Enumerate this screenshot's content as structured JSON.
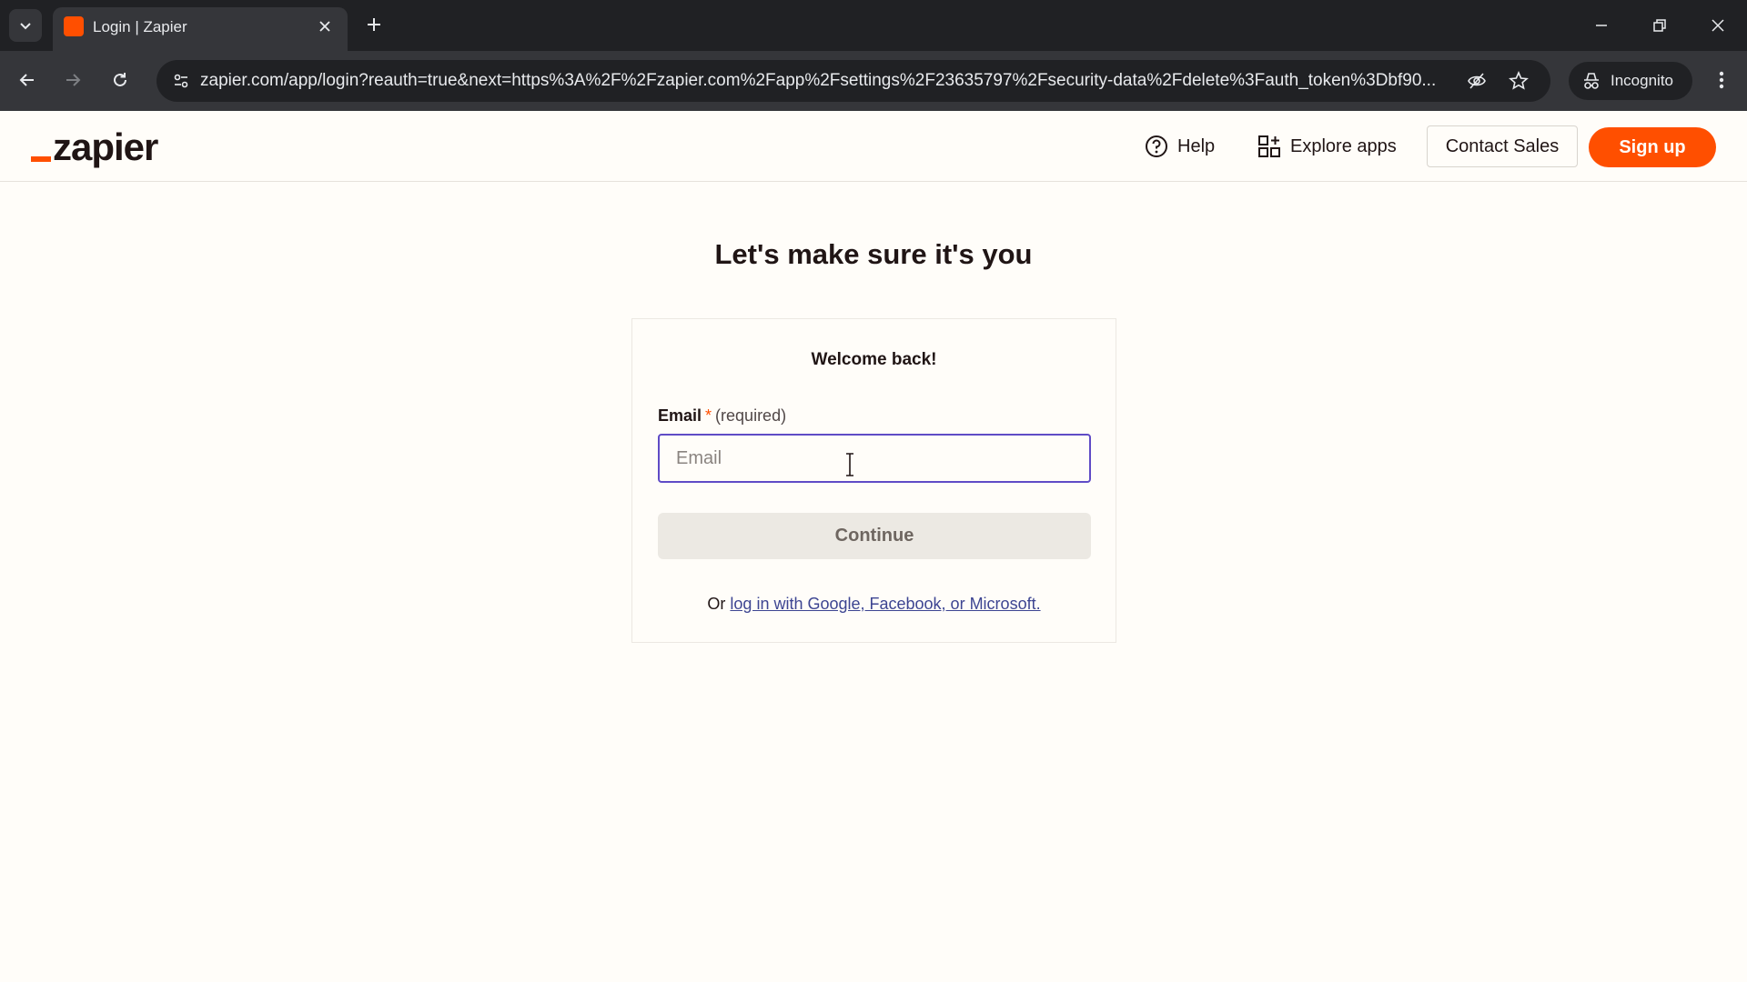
{
  "browser": {
    "tab_title": "Login | Zapier",
    "url": "zapier.com/app/login?reauth=true&next=https%3A%2F%2Fzapier.com%2Fapp%2Fsettings%2F23635797%2Fsecurity-data%2Fdelete%3Fauth_token%3Dbf90...",
    "incognito_label": "Incognito"
  },
  "header": {
    "logo_text": "zapier",
    "help_label": "Help",
    "explore_label": "Explore apps",
    "contact_label": "Contact Sales",
    "signup_label": "Sign up"
  },
  "login": {
    "heading": "Let's make sure it's you",
    "welcome": "Welcome back!",
    "email_label": "Email",
    "required_star": "*",
    "required_text": "(required)",
    "email_placeholder": "Email",
    "email_value": "",
    "continue_label": "Continue",
    "alt_prefix": "Or ",
    "alt_link": "log in with Google, Facebook, or Microsoft."
  },
  "colors": {
    "brand": "#ff4f00",
    "focus": "#5f4bc6",
    "link": "#3d4592"
  }
}
